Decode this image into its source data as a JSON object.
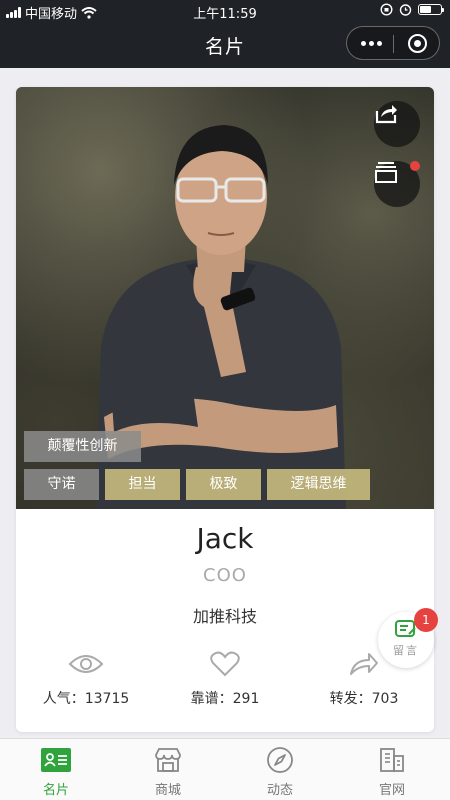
{
  "status_bar": {
    "carrier": "中国移动",
    "time": "上午11:59",
    "battery_level": 0.55
  },
  "nav": {
    "title": "名片"
  },
  "card": {
    "tags_row1": [
      "颠覆性创新"
    ],
    "tags_row2": [
      "守诺",
      "担当",
      "极致",
      "逻辑思维"
    ],
    "name": "Jack",
    "role": "COO",
    "company": "加推科技",
    "stats": [
      {
        "icon": "eye-icon",
        "label": "人气：13715"
      },
      {
        "icon": "heart-icon",
        "label": "靠谱：291"
      },
      {
        "icon": "forward-icon",
        "label": "转发：703"
      }
    ]
  },
  "message_button": {
    "label": "留言",
    "badge": "1"
  },
  "tabbar": {
    "items": [
      {
        "label": "名片",
        "icon": "id-card-icon",
        "active": true
      },
      {
        "label": "商城",
        "icon": "store-icon",
        "active": false
      },
      {
        "label": "动态",
        "icon": "compass-icon",
        "active": false
      },
      {
        "label": "官网",
        "icon": "building-icon",
        "active": false
      }
    ]
  },
  "colors": {
    "accent": "#2fa43c",
    "badge": "#e64340",
    "nav_bg": "#1f2226",
    "tag_gold": "#c4b97c",
    "tag_gray": "#8c8c8c"
  }
}
